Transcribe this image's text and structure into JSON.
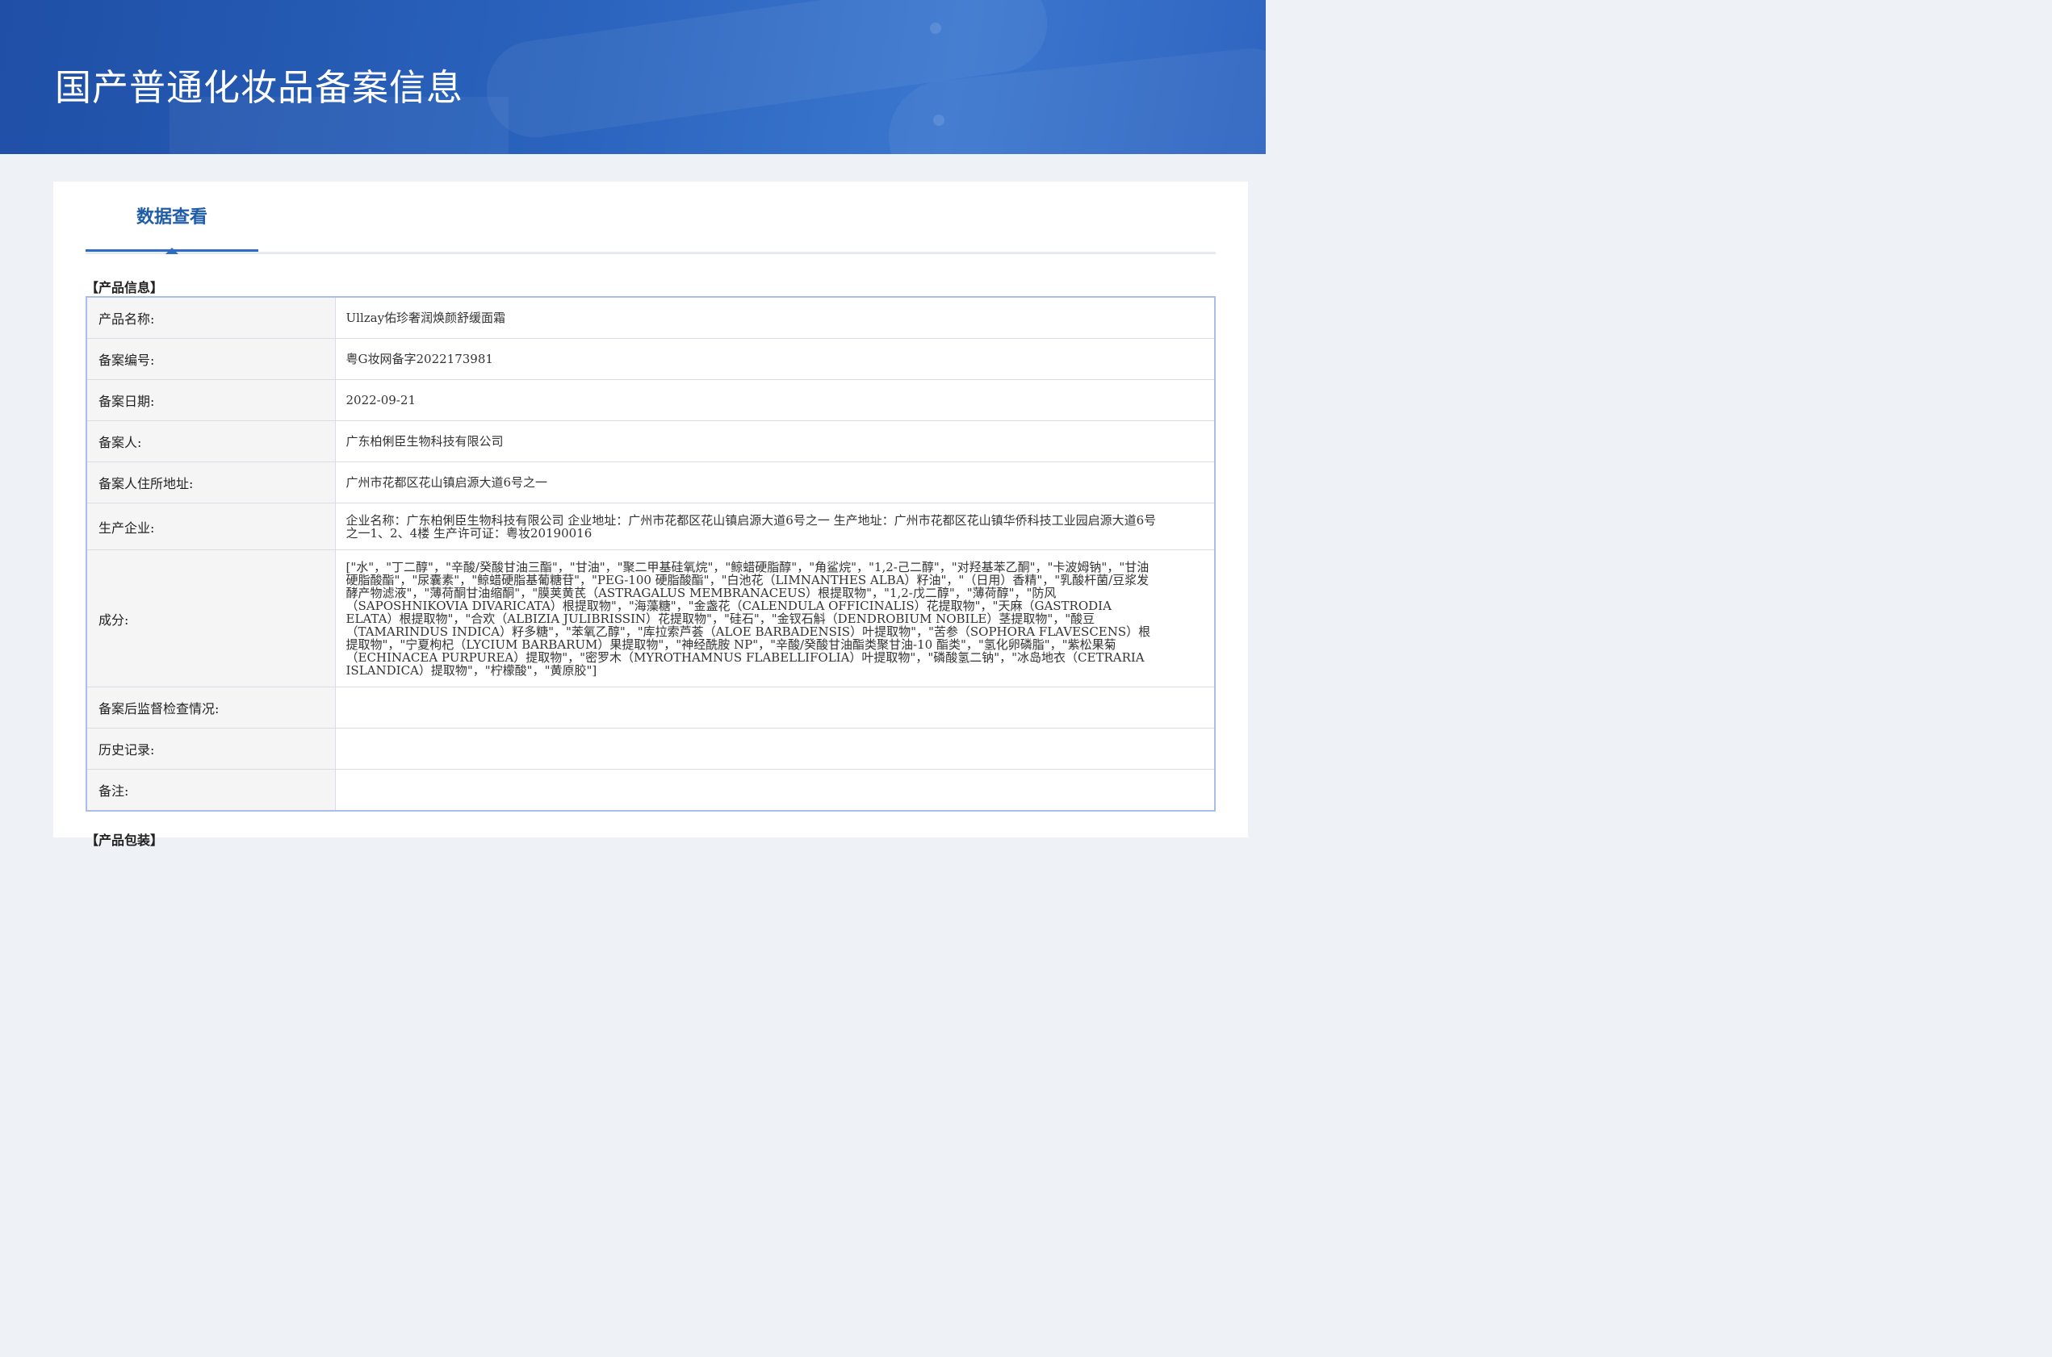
{
  "banner": {
    "title": "国产普通化妆品备案信息"
  },
  "tabs": [
    {
      "label": "数据查看",
      "active": true
    }
  ],
  "sections": {
    "product_info_title": "【产品信息】",
    "next_section_title": "【产品包装】"
  },
  "product_info": {
    "rows": [
      {
        "label": "产品名称:",
        "value": "Ullzay佑珍奢润焕颜舒缓面霜"
      },
      {
        "label": "备案编号:",
        "value": "粤G妆网备字2022173981"
      },
      {
        "label": "备案日期:",
        "value": "2022-09-21"
      },
      {
        "label": "备案人:",
        "value": "广东柏俐臣生物科技有限公司"
      },
      {
        "label": "备案人住所地址:",
        "value": "广州市花都区花山镇启源大道6号之一"
      },
      {
        "label": "生产企业:",
        "value": "企业名称：广东柏俐臣生物科技有限公司 企业地址：广州市花都区花山镇启源大道6号之一 生产地址：广州市花都区花山镇华侨科技工业园启源大道6号之一1、2、4楼 生产许可证：粤妆20190016"
      },
      {
        "label": "成分:",
        "value": "[\"水\"，\"丁二醇\"，\"辛酸/癸酸甘油三酯\"，\"甘油\"，\"聚二甲基硅氧烷\"，\"鲸蜡硬脂醇\"，\"角鲨烷\"，\"1,2-己二醇\"，\"对羟基苯乙酮\"，\"卡波姆钠\"，\"甘油硬脂酸酯\"，\"尿囊素\"，\"鲸蜡硬脂基葡糖苷\"，\"PEG-100 硬脂酸酯\"，\"白池花（LIMNANTHES ALBA）籽油\"，\"（日用）香精\"，\"乳酸杆菌/豆浆发酵产物滤液\"，\"薄荷酮甘油缩酮\"，\"膜荚黄芪（ASTRAGALUS MEMBRANACEUS）根提取物\"，\"1,2-戊二醇\"，\"薄荷醇\"，\"防风（SAPOSHNIKOVIA DIVARICATA）根提取物\"，\"海藻糖\"，\"金盏花（CALENDULA OFFICINALIS）花提取物\"，\"天麻（GASTRODIA ELATA）根提取物\"，\"合欢（ALBIZIA JULIBRISSIN）花提取物\"，\"硅石\"，\"金钗石斛（DENDROBIUM NOBILE）茎提取物\"，\"酸豆（TAMARINDUS INDICA）籽多糖\"，\"苯氧乙醇\"，\"库拉索芦荟（ALOE BARBADENSIS）叶提取物\"，\"苦参（SOPHORA FLAVESCENS）根提取物\"，\"宁夏枸杞（LYCIUM BARBARUM）果提取物\"，\"神经酰胺 NP\"，\"辛酸/癸酸甘油酯类聚甘油-10 酯类\"，\"氢化卵磷脂\"，\"紫松果菊（ECHINACEA PURPUREA）提取物\"，\"密罗木（MYROTHAMNUS FLABELLIFOLIA）叶提取物\"，\"磷酸氢二钠\"，\"冰岛地衣（CETRARIA ISLANDICA）提取物\"，\"柠檬酸\"，\"黄原胶\"]"
      },
      {
        "label": "备案后监督检查情况:",
        "value": ""
      },
      {
        "label": "历史记录:",
        "value": ""
      },
      {
        "label": "备注:",
        "value": ""
      }
    ]
  },
  "colors": {
    "banner_dark": "#1f4fa6",
    "banner_light": "#3b77cf",
    "tab_active": "#1f5ca8",
    "table_border": "#a9bfe6",
    "label_bg": "#f5f5f5",
    "page_bg": "#eef2f6"
  }
}
